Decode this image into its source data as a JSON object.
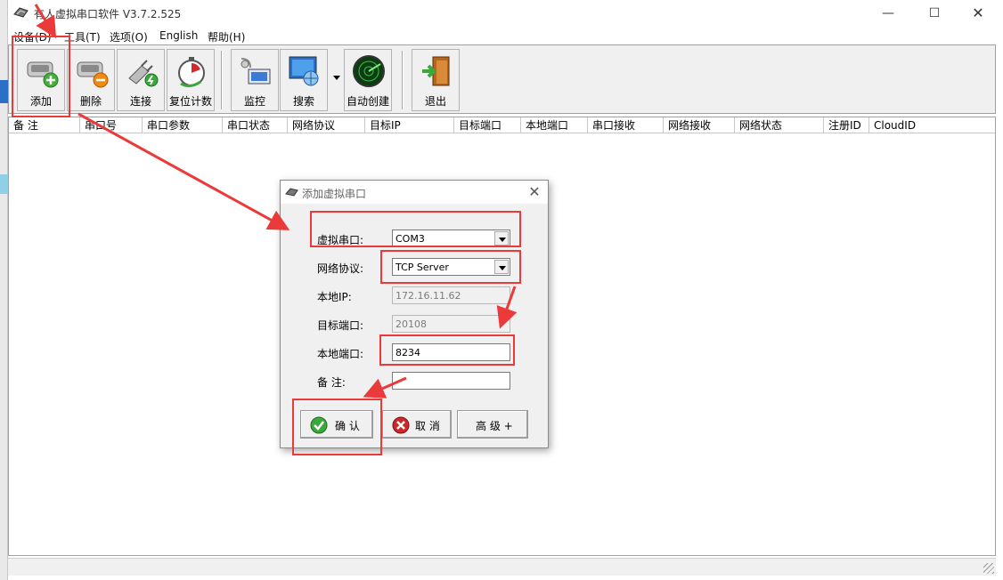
{
  "window": {
    "title": "有人虚拟串口软件 V3.7.2.525",
    "minimize": "—",
    "maximize": "☐",
    "close": "✕"
  },
  "menu": {
    "items": [
      "设备(D)",
      "工具(T)",
      "选项(O)",
      "English",
      "帮助(H)"
    ]
  },
  "toolbar": {
    "add": "添加",
    "delete": "删除",
    "connect": "连接",
    "reset_count": "复位计数",
    "monitor": "监控",
    "search": "搜索",
    "auto_create": "自动创建",
    "exit": "退出"
  },
  "list": {
    "columns": [
      "备 注",
      "串口号",
      "串口参数",
      "串口状态",
      "网络协议",
      "目标IP",
      "目标端口",
      "本地端口",
      "串口接收",
      "网络接收",
      "网络状态",
      "注册ID",
      "CloudID"
    ]
  },
  "dialog": {
    "title": "添加虚拟串口",
    "close": "✕",
    "fields": {
      "virtual_port_label": "虚拟串口:",
      "virtual_port_value": "COM3",
      "protocol_label": "网络协议:",
      "protocol_value": "TCP Server",
      "local_ip_label": "本地IP:",
      "local_ip_value": "172.16.11.62",
      "target_port_label": "目标端口:",
      "target_port_value": "20108",
      "local_port_label": "本地端口:",
      "local_port_value": "8234",
      "note_label": "备 注:",
      "note_value": ""
    },
    "buttons": {
      "confirm": "确 认",
      "cancel": "取 消",
      "advanced": "高 级 +"
    }
  },
  "colors": {
    "annotation_red": "#ea3a3a",
    "confirm_green": "#3aa83a",
    "cancel_red": "#cc2a2a"
  }
}
